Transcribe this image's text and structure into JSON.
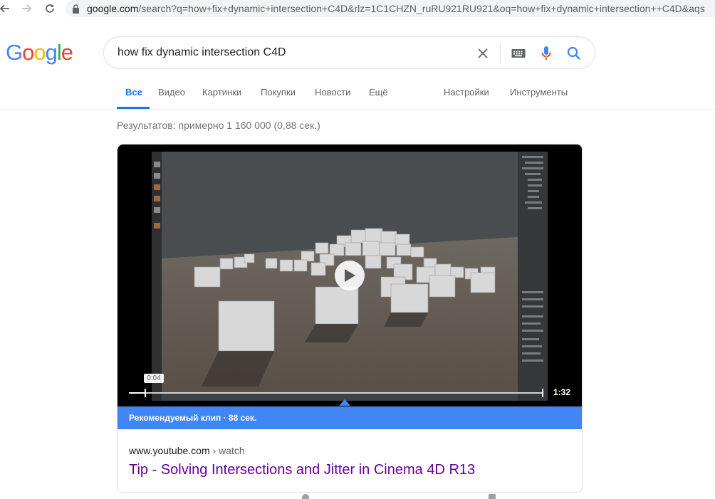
{
  "browser": {
    "back_icon": "arrow-left-icon",
    "forward_icon": "arrow-right-icon",
    "reload_icon": "reload-icon",
    "lock_icon": "lock-icon",
    "url_host": "google.com",
    "url_rest": "/search?q=how+fix+dynamic+intersection+C4D&rlz=1C1CHZN_ruRU921RU921&oq=how+fix+dynamic+intersection++C4D&aqs"
  },
  "logo": {
    "letters": [
      "G",
      "o",
      "o",
      "g",
      "l",
      "e"
    ],
    "colors": [
      "#4285f4",
      "#ea4335",
      "#fbbc05",
      "#4285f4",
      "#34a853",
      "#ea4335"
    ]
  },
  "search": {
    "query": "how fix dynamic intersection C4D",
    "clear_icon": "close-icon",
    "keyboard_icon": "keyboard-icon",
    "mic_icon": "microphone-icon",
    "search_icon": "search-icon"
  },
  "tabs": {
    "all": "Все",
    "video": "Видео",
    "images": "Картинки",
    "shopping": "Покупки",
    "news": "Новости",
    "more": "Ещё",
    "settings": "Настройки",
    "tools": "Инструменты",
    "active_color": "#1a73e8"
  },
  "stats": "Результатов: примерно 1 160 000 (0,88 сек.)",
  "video_result": {
    "current_time": "0:04",
    "duration": "1:32",
    "progress_fraction": 0.04,
    "play_icon": "play-icon",
    "clip_label": "Рекомендуемый клип · 88 сек.",
    "clip_color": "#4285f4",
    "source_host": "www.youtube.com",
    "source_path": "› watch",
    "title": "Tip - Solving Intersections and Jitter in Cinema 4D R13",
    "title_color": "#660099"
  }
}
